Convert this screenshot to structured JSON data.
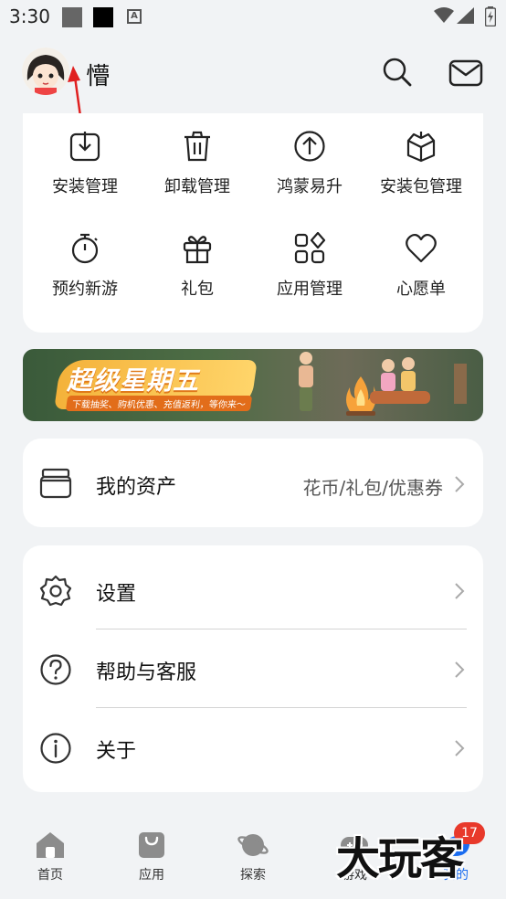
{
  "status_bar": {
    "time": "3:30",
    "icon_a": "A"
  },
  "header": {
    "user_name": "懵"
  },
  "grid": [
    {
      "label": "安装管理",
      "icon": "download-box-icon"
    },
    {
      "label": "卸载管理",
      "icon": "trash-icon"
    },
    {
      "label": "鸿蒙易升",
      "icon": "upgrade-arrow-icon"
    },
    {
      "label": "安装包管理",
      "icon": "package-icon"
    },
    {
      "label": "预约新游",
      "icon": "stopwatch-icon"
    },
    {
      "label": "礼包",
      "icon": "gift-icon"
    },
    {
      "label": "应用管理",
      "icon": "apps-grid-icon"
    },
    {
      "label": "心愿单",
      "icon": "heart-icon"
    }
  ],
  "banner": {
    "title": "超级星期五",
    "subtitle": "下载抽奖、购机优惠、充值返利，等你来～"
  },
  "assets": {
    "label": "我的资产",
    "value": "花币/礼包/优惠券"
  },
  "settings_list": [
    {
      "label": "设置",
      "icon": "gear-icon"
    },
    {
      "label": "帮助与客服",
      "icon": "help-icon"
    },
    {
      "label": "关于",
      "icon": "info-icon"
    }
  ],
  "bottom_nav": [
    {
      "label": "首页",
      "icon": "home-icon"
    },
    {
      "label": "应用",
      "icon": "shopping-bag-icon"
    },
    {
      "label": "探索",
      "icon": "planet-icon"
    },
    {
      "label": "游戏",
      "icon": "gamepad-icon"
    },
    {
      "label": "我的",
      "icon": "profile-icon",
      "active": true
    }
  ],
  "badge_count": "17",
  "watermark": "大玩客",
  "colors": {
    "accent": "#1a6cf0",
    "badge": "#e8392b",
    "background": "#f1f3f5",
    "banner_orange": "#f4b23a"
  }
}
